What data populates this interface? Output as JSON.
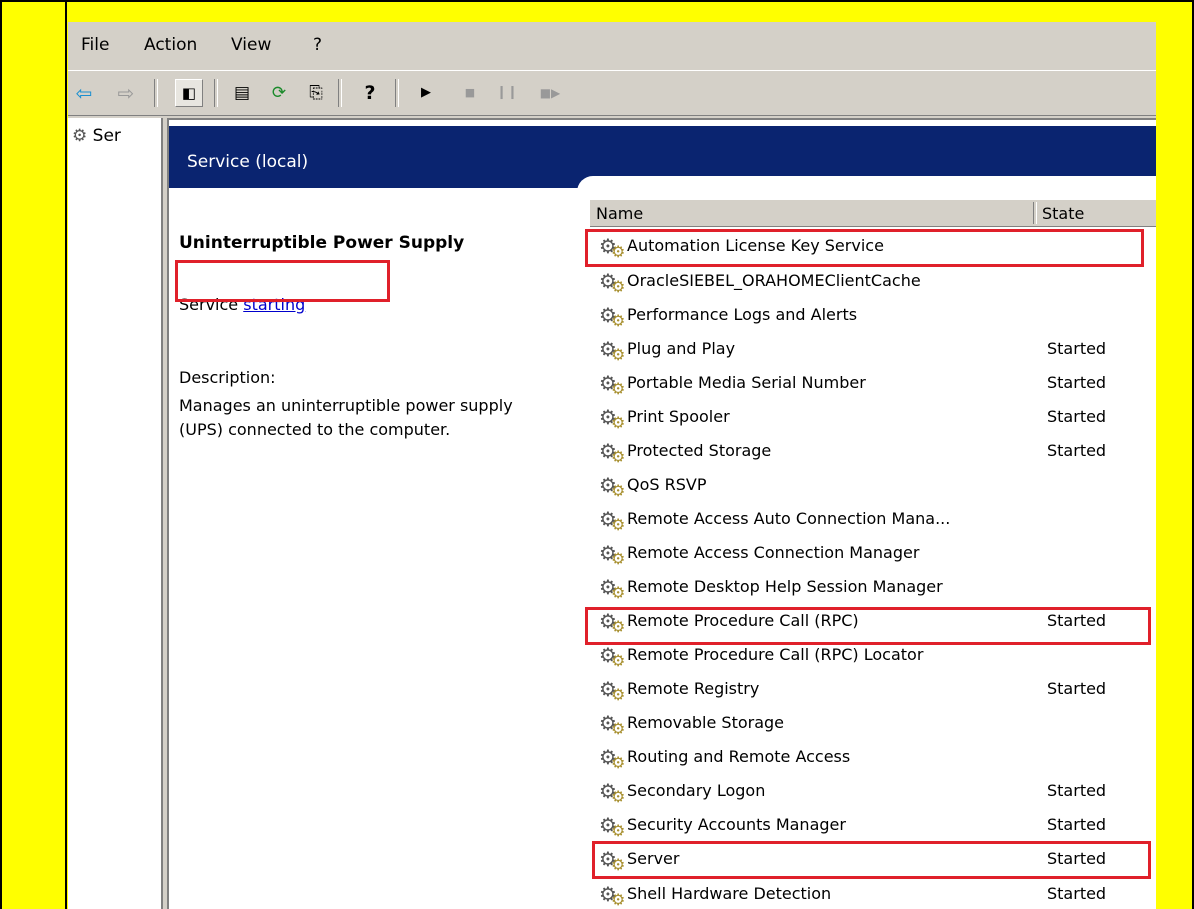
{
  "menu": [
    "File",
    "Action",
    "View",
    "?"
  ],
  "toolbar": {
    "icons": [
      "back-arrow-icon",
      "forward-arrow-icon",
      "show-hide-tree-icon",
      "properties-icon",
      "refresh-icon",
      "export-list-icon",
      "help-icon",
      "start-service-icon",
      "stop-service-icon",
      "pause-service-icon",
      "restart-service-icon"
    ]
  },
  "tree": {
    "item_label": "Ser"
  },
  "header": {
    "title": "Service (local)"
  },
  "detail": {
    "title": "Uninterruptible Power Supply",
    "status_prefix": "Service",
    "status_link": "starting",
    "desc_label": "Description:",
    "desc_text_1": "Manages an uninterruptible power supply",
    "desc_text_2": "(UPS) connected to the computer."
  },
  "list": {
    "columns": [
      "Name",
      "State"
    ],
    "rows": [
      {
        "name": "Automation License Key Service",
        "state": ""
      },
      {
        "name": "OracleSIEBEL_ORAHOMEClientCache",
        "state": ""
      },
      {
        "name": "Performance Logs and Alerts",
        "state": ""
      },
      {
        "name": "Plug and Play",
        "state": "Started"
      },
      {
        "name": "Portable Media Serial Number",
        "state": "Started"
      },
      {
        "name": "Print Spooler",
        "state": "Started"
      },
      {
        "name": "Protected Storage",
        "state": "Started"
      },
      {
        "name": "QoS RSVP",
        "state": ""
      },
      {
        "name": "Remote Access Auto Connection Mana...",
        "state": ""
      },
      {
        "name": "Remote Access Connection Manager",
        "state": ""
      },
      {
        "name": "Remote Desktop Help Session Manager",
        "state": ""
      },
      {
        "name": "Remote Procedure Call (RPC)",
        "state": "Started"
      },
      {
        "name": "Remote Procedure Call (RPC) Locator",
        "state": ""
      },
      {
        "name": "Remote Registry",
        "state": "Started"
      },
      {
        "name": "Removable Storage",
        "state": ""
      },
      {
        "name": "Routing and Remote Access",
        "state": ""
      },
      {
        "name": "Secondary Logon",
        "state": "Started"
      },
      {
        "name": "Security Accounts Manager",
        "state": "Started"
      },
      {
        "name": "Server",
        "state": "Started"
      },
      {
        "name": "Shell Hardware Detection",
        "state": "Started"
      }
    ]
  },
  "highlight_color": "#e0202a",
  "frame_color": "#ffff00",
  "header_color": "#0a2470"
}
